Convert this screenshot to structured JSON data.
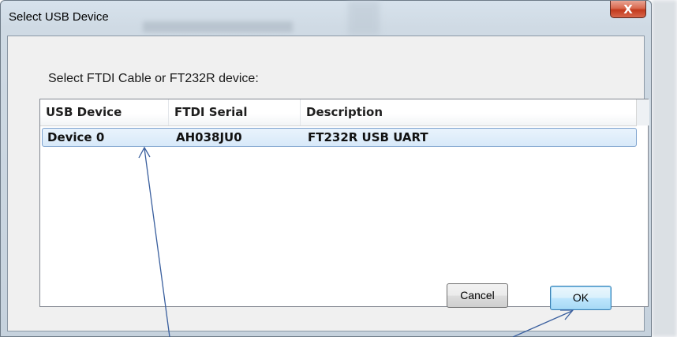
{
  "window": {
    "title": "Select USB Device",
    "close_label": "X"
  },
  "prompt": "Select FTDI Cable or  FT232R device:",
  "list": {
    "columns": [
      "USB Device",
      "FTDI Serial",
      "Description"
    ],
    "rows": [
      {
        "device": "Device 0",
        "serial": "AH038JU0",
        "description": "FT232R USB UART",
        "selected": true
      }
    ]
  },
  "buttons": {
    "cancel": "Cancel",
    "ok": "OK"
  },
  "colors": {
    "selection": "#d8e9f9",
    "selection_border": "#7da2ce",
    "annotation_arrow": "#3a5f9e",
    "close_button": "#c23a1d"
  }
}
